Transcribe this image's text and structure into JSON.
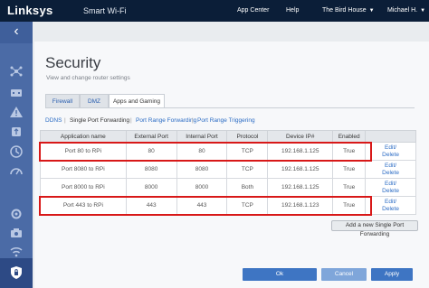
{
  "header": {
    "logo": "Linksys",
    "product": "Smart Wi-Fi",
    "nav": {
      "app_center": "App Center",
      "help": "Help",
      "network": "The Bird House",
      "user": "Michael H."
    }
  },
  "sidebar": {
    "back_icon": "chevron-left-icon",
    "icons": [
      "device-list-icon",
      "router-icon",
      "alert-icon",
      "parental-controls-icon",
      "media-prioritization-icon",
      "speed-test-icon",
      "settings-icon",
      "camera-icon",
      "wifi-icon",
      "security-icon"
    ]
  },
  "page": {
    "title": "Security",
    "description": "View and change router settings"
  },
  "tabs": [
    "Firewall",
    "DMZ",
    "Apps and Gaming"
  ],
  "active_tab": "Apps and Gaming",
  "subtabs": [
    "DDNS",
    "Single Port Forwarding",
    "Port Range Forwarding",
    "Port Range Triggering"
  ],
  "active_subtab": "Single Port Forwarding",
  "table": {
    "headers": [
      "Application name",
      "External Port",
      "Internal Port",
      "Protocol",
      "Device IP#",
      "Enabled",
      ""
    ],
    "rows": [
      {
        "name": "Port 80 to RPi",
        "ext": "80",
        "int": "80",
        "protocol": "TCP",
        "ip": "192.168.1.125",
        "enabled": "True",
        "edit": "Edit/",
        "delete": "Delete"
      },
      {
        "name": "Port 8080 to RPi",
        "ext": "8080",
        "int": "8080",
        "protocol": "TCP",
        "ip": "192.168.1.125",
        "enabled": "True",
        "edit": "Edit/",
        "delete": "Delete"
      },
      {
        "name": "Port 8000 to RPi",
        "ext": "8000",
        "int": "8000",
        "protocol": "Both",
        "ip": "192.168.1.125",
        "enabled": "True",
        "edit": "Edit/",
        "delete": "Delete"
      },
      {
        "name": "Port 443 to RPi",
        "ext": "443",
        "int": "443",
        "protocol": "TCP",
        "ip": "192.168.1.123",
        "enabled": "True",
        "edit": "Edit/",
        "delete": "Delete"
      }
    ]
  },
  "add_button": "Add a new Single Port Forwarding",
  "footer": {
    "ok": "Ok",
    "cancel": "Cancel",
    "apply": "Apply"
  },
  "colors": {
    "topbar": "#0b1e38",
    "sidebar": "#4b6ba6",
    "highlight": "#d81818",
    "primary_button": "#3e75c3"
  }
}
